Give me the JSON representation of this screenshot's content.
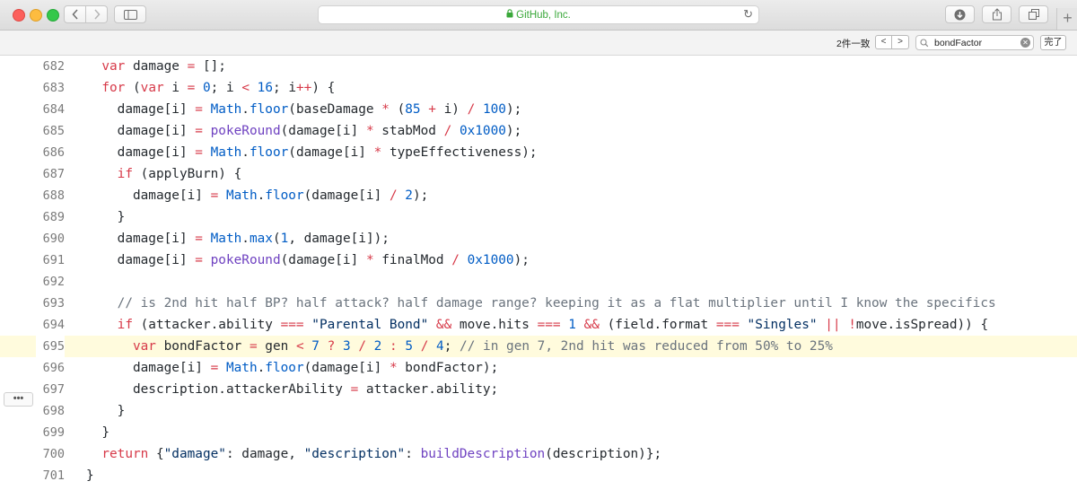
{
  "browser": {
    "url_display": "GitHub, Inc.",
    "lock_glyph": "🔒"
  },
  "findbar": {
    "count": "2件一致",
    "prev": "<",
    "next": ">",
    "query": "bondFactor",
    "done": "完了"
  },
  "code": {
    "more": "•••",
    "lines": [
      {
        "n": "682",
        "html": "  <span class=\"kw\">var</span> damage <span class=\"kw\">=</span> [];"
      },
      {
        "n": "683",
        "html": "  <span class=\"kw\">for</span> (<span class=\"kw\">var</span> i <span class=\"kw\">=</span> <span class=\"num\">0</span>; i <span class=\"kw\">&lt;</span> <span class=\"num\">16</span>; i<span class=\"kw\">++</span>) {"
      },
      {
        "n": "684",
        "html": "    damage[i] <span class=\"kw\">=</span> <span class=\"fn\">Math</span>.<span class=\"fn\">floor</span>(baseDamage <span class=\"kw\">*</span> (<span class=\"num\">85</span> <span class=\"kw\">+</span> i) <span class=\"kw\">/</span> <span class=\"num\">100</span>);"
      },
      {
        "n": "685",
        "html": "    damage[i] <span class=\"kw\">=</span> <span class=\"pf\">pokeRound</span>(damage[i] <span class=\"kw\">*</span> stabMod <span class=\"kw\">/</span> <span class=\"num\">0x1000</span>);"
      },
      {
        "n": "686",
        "html": "    damage[i] <span class=\"kw\">=</span> <span class=\"fn\">Math</span>.<span class=\"fn\">floor</span>(damage[i] <span class=\"kw\">*</span> typeEffectiveness);"
      },
      {
        "n": "687",
        "html": "    <span class=\"kw\">if</span> (applyBurn) {"
      },
      {
        "n": "688",
        "html": "      damage[i] <span class=\"kw\">=</span> <span class=\"fn\">Math</span>.<span class=\"fn\">floor</span>(damage[i] <span class=\"kw\">/</span> <span class=\"num\">2</span>);"
      },
      {
        "n": "689",
        "html": "    }"
      },
      {
        "n": "690",
        "html": "    damage[i] <span class=\"kw\">=</span> <span class=\"fn\">Math</span>.<span class=\"fn\">max</span>(<span class=\"num\">1</span>, damage[i]);"
      },
      {
        "n": "691",
        "html": "    damage[i] <span class=\"kw\">=</span> <span class=\"pf\">pokeRound</span>(damage[i] <span class=\"kw\">*</span> finalMod <span class=\"kw\">/</span> <span class=\"num\">0x1000</span>);"
      },
      {
        "n": "692",
        "html": ""
      },
      {
        "n": "693",
        "html": "    <span class=\"cm\">// is 2nd hit half BP? half attack? half damage range? keeping it as a flat multiplier until I know the specifics</span>"
      },
      {
        "n": "694",
        "html": "    <span class=\"kw\">if</span> (attacker.ability <span class=\"kw\">===</span> <span class=\"str\">\"Parental Bond\"</span> <span class=\"kw\">&amp;&amp;</span> move.hits <span class=\"kw\">===</span> <span class=\"num\">1</span> <span class=\"kw\">&amp;&amp;</span> (field.format <span class=\"kw\">===</span> <span class=\"str\">\"Singles\"</span> <span class=\"kw\">||</span> <span class=\"kw\">!</span>move.isSpread)) {"
      },
      {
        "n": "695",
        "hl": true,
        "html": "      <span class=\"kw\">var</span> bondFactor <span class=\"kw\">=</span> gen <span class=\"kw\">&lt;</span> <span class=\"num\">7</span> <span class=\"kw\">?</span> <span class=\"num\">3</span> <span class=\"kw\">/</span> <span class=\"num\">2</span> <span class=\"kw\">:</span> <span class=\"num\">5</span> <span class=\"kw\">/</span> <span class=\"num\">4</span>; <span class=\"cm\">// in gen 7, 2nd hit was reduced from 50% to 25%</span>"
      },
      {
        "n": "696",
        "html": "      damage[i] <span class=\"kw\">=</span> <span class=\"fn\">Math</span>.<span class=\"fn\">floor</span>(damage[i] <span class=\"kw\">*</span> bondFactor);"
      },
      {
        "n": "697",
        "html": "      description.attackerAbility <span class=\"kw\">=</span> attacker.ability;"
      },
      {
        "n": "698",
        "html": "    }"
      },
      {
        "n": "699",
        "html": "  }"
      },
      {
        "n": "700",
        "html": "  <span class=\"kw\">return</span> {<span class=\"str\">\"damage\"</span>: damage, <span class=\"str\">\"description\"</span>: <span class=\"pf\">buildDescription</span>(description)};"
      },
      {
        "n": "701",
        "html": "}"
      }
    ]
  }
}
